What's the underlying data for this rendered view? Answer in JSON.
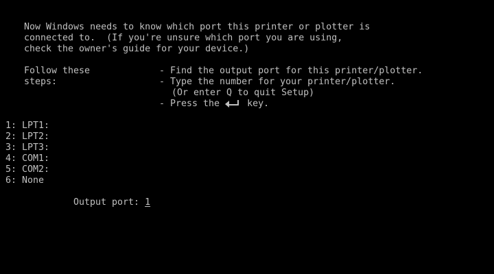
{
  "colors": {
    "background": "#000000",
    "text": "#c0c0c0"
  },
  "intro": {
    "line1": "Now Windows needs to know which port this printer or plotter is",
    "line2": "connected to.  (If you're unsure which port you are using,",
    "line3": "check the owner's guide for your device.)"
  },
  "steps": {
    "label_line1": "Follow these",
    "label_line2": "steps:",
    "step1": "- Find the output port for this printer/plotter.",
    "step2": "- Type the number for your printer/plotter.",
    "step2_note": "(Or enter Q to quit Setup)",
    "step3_prefix": "- Press the",
    "step3_icon": "enter-key-icon",
    "step3_suffix": "key."
  },
  "ports": [
    {
      "label": "1: LPT1:"
    },
    {
      "label": "2: LPT2:"
    },
    {
      "label": "3: LPT3:"
    },
    {
      "label": "4: COM1:"
    },
    {
      "label": "5: COM2:"
    },
    {
      "label": "6: None"
    }
  ],
  "output_port": {
    "label": "Output port:",
    "value": "1"
  }
}
